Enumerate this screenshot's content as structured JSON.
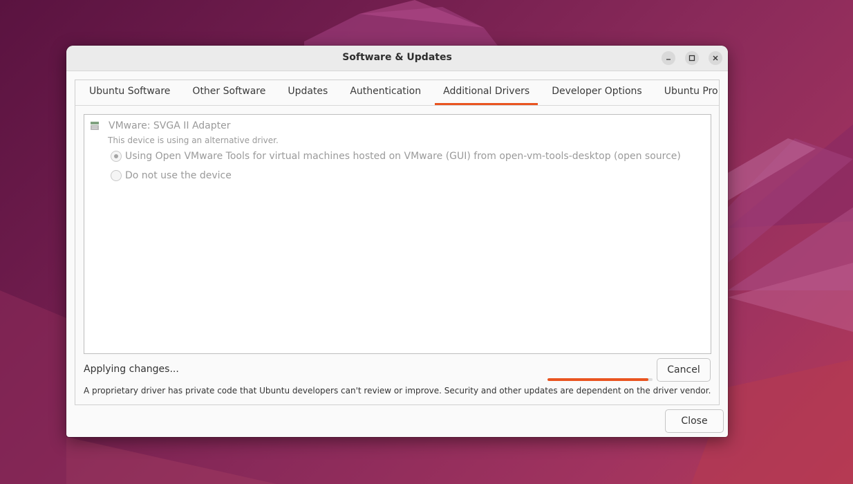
{
  "window": {
    "title": "Software & Updates",
    "controls": [
      "minimize-icon",
      "maximize-icon",
      "close-icon"
    ]
  },
  "tabs": [
    {
      "label": "Ubuntu Software",
      "active": false
    },
    {
      "label": "Other Software",
      "active": false
    },
    {
      "label": "Updates",
      "active": false
    },
    {
      "label": "Authentication",
      "active": false
    },
    {
      "label": "Additional Drivers",
      "active": true
    },
    {
      "label": "Developer Options",
      "active": false
    },
    {
      "label": "Ubuntu Pro",
      "active": false
    }
  ],
  "device": {
    "name": "VMware: SVGA II Adapter",
    "status": "This device is using an alternative driver.",
    "icon": "hardware-chip-icon",
    "options": [
      {
        "label": "Using Open VMware Tools for virtual machines hosted on VMware (GUI) from open-vm-tools-desktop (open source)",
        "selected": true
      },
      {
        "label": "Do not use the device",
        "selected": false
      }
    ]
  },
  "status": {
    "text": "Applying changes...",
    "progress": 0.96,
    "cancel_label": "Cancel"
  },
  "disclaimer": "A proprietary driver has private code that Ubuntu developers can't review or improve. Security and other updates are dependent on the driver vendor.",
  "close_label": "Close",
  "colors": {
    "accent": "#e95420",
    "wallpaper": "#6e1c4c"
  }
}
